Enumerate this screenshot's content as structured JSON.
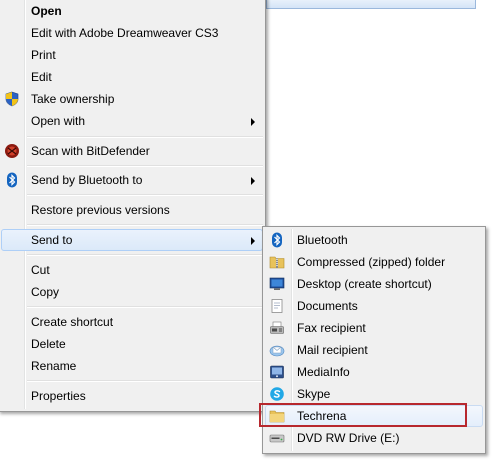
{
  "context_menu": {
    "items": [
      {
        "label": "Open",
        "bold": true
      },
      {
        "label": "Edit with Adobe Dreamweaver CS3"
      },
      {
        "label": "Print"
      },
      {
        "label": "Edit"
      },
      {
        "label": "Take ownership",
        "icon": "uac-shield-icon"
      },
      {
        "label": "Open with",
        "submenu": true
      },
      {
        "label": "Scan with BitDefender",
        "icon": "bitdefender-icon"
      },
      {
        "label": "Send by Bluetooth to",
        "icon": "bluetooth-icon",
        "submenu": true
      },
      {
        "label": "Restore previous versions"
      },
      {
        "label": "Send to",
        "submenu": true,
        "highlighted": true
      },
      {
        "label": "Cut"
      },
      {
        "label": "Copy"
      },
      {
        "label": "Create shortcut"
      },
      {
        "label": "Delete"
      },
      {
        "label": "Rename"
      },
      {
        "label": "Properties"
      }
    ]
  },
  "send_to_menu": {
    "items": [
      {
        "label": "Bluetooth",
        "icon": "bluetooth-icon"
      },
      {
        "label": "Compressed (zipped) folder",
        "icon": "zip-folder-icon"
      },
      {
        "label": "Desktop (create shortcut)",
        "icon": "desktop-icon"
      },
      {
        "label": "Documents",
        "icon": "documents-icon"
      },
      {
        "label": "Fax recipient",
        "icon": "fax-icon"
      },
      {
        "label": "Mail recipient",
        "icon": "mail-icon"
      },
      {
        "label": "MediaInfo",
        "icon": "mediainfo-icon"
      },
      {
        "label": "Skype",
        "icon": "skype-icon"
      },
      {
        "label": "Techrena",
        "icon": "folder-icon",
        "marked": true
      },
      {
        "label": "DVD RW Drive (E:)",
        "icon": "dvd-drive-icon"
      }
    ]
  },
  "colors": {
    "menu_background": "#f0f0f0",
    "highlight_border": "#aecff7",
    "annotation_box": "#b7282e"
  }
}
